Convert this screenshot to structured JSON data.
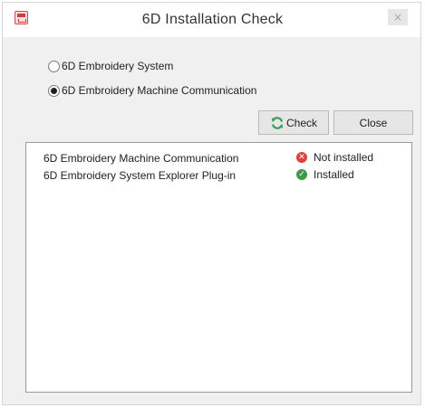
{
  "window": {
    "title": "6D Installation Check",
    "close_glyph": "×"
  },
  "options": {
    "items": [
      {
        "label": "6D Embroidery System",
        "selected": false
      },
      {
        "label": "6D Embroidery Machine Communication",
        "selected": true
      }
    ]
  },
  "buttons": {
    "check_label": "Check",
    "close_label": "Close",
    "check_icon": "refresh-icon"
  },
  "results": {
    "rows": [
      {
        "name": "6D Embroidery Machine Communication",
        "status": "Not installed",
        "status_icon": "error-icon",
        "status_color": "#d9433b"
      },
      {
        "name": "6D Embroidery System Explorer Plug-in",
        "status": "Installed",
        "status_icon": "check-icon",
        "status_color": "#3e9a4a"
      }
    ]
  },
  "colors": {
    "window_bg": "#f0f0f0",
    "titlebar_bg": "#ffffff",
    "list_bg": "#ffffff",
    "error": "#d9433b",
    "success": "#3e9a4a",
    "refresh_icon": "#3aa055"
  }
}
